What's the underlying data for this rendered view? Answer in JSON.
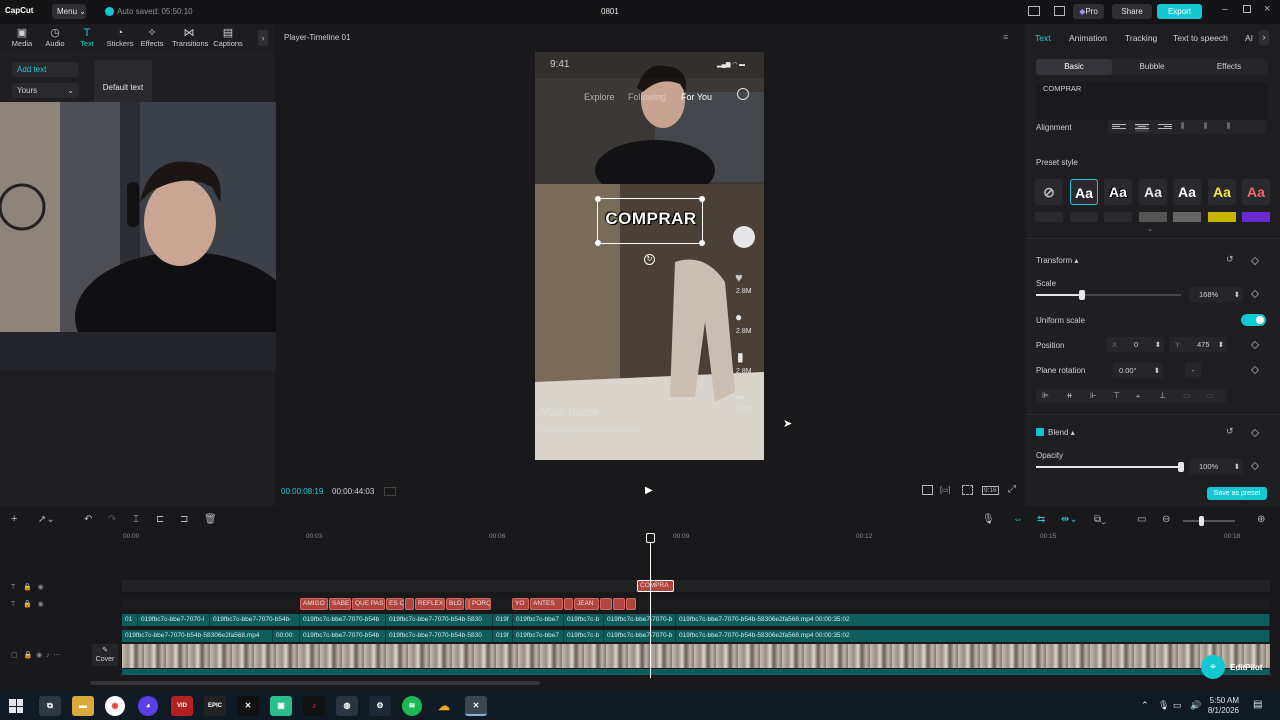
{
  "app": {
    "logo": "CapCut",
    "menu_label": "Menu",
    "autosave": "Auto saved: 05:50:10",
    "project_name": "0801",
    "pro_label": "Pro",
    "share_label": "Share",
    "export_label": "Export",
    "accent": "#13c8d2"
  },
  "tools": [
    {
      "label": "Media",
      "icon": "media-icon"
    },
    {
      "label": "Audio",
      "icon": "audio-icon"
    },
    {
      "label": "Text",
      "icon": "text-icon"
    },
    {
      "label": "Stickers",
      "icon": "stickers-icon"
    },
    {
      "label": "Effects",
      "icon": "effects-icon"
    },
    {
      "label": "Transitions",
      "icon": "transitions-icon"
    },
    {
      "label": "Captions",
      "icon": "captions-icon"
    }
  ],
  "left_panel": {
    "add_text": "Add text",
    "dropdown": "Yours",
    "default_text": "Default text"
  },
  "player": {
    "title": "Player-Timeline 01",
    "current_time": "00:00:08:19",
    "total_time": "00:00:44:03",
    "phone": {
      "time": "9:41",
      "tabs": [
        "Explore",
        "Following",
        "For You"
      ],
      "overlay_text": "COMPRAR",
      "counts": [
        "2.8M",
        "2.8M",
        "2.8M",
        "2.8M"
      ],
      "username": "Your name",
      "caption": "Here is your video description title"
    }
  },
  "right_panel": {
    "tabs": [
      "Text",
      "Animation",
      "Tracking",
      "Text to speech",
      "AI"
    ],
    "subtabs": [
      "Basic",
      "Bubble",
      "Effects"
    ],
    "text_value": "COMPRAR",
    "alignment_label": "Alignment",
    "preset_label": "Preset style",
    "preset_glyph": "Aa",
    "transform_label": "Transform",
    "scale_label": "Scale",
    "scale_value": "168%",
    "scale_fraction": 0.32,
    "uniform_scale_label": "Uniform scale",
    "position_label": "Position",
    "pos_x_label": "X",
    "pos_x": "0",
    "pos_y_label": "Y",
    "pos_y": "475",
    "rotation_label": "Plane rotation",
    "rotation_value": "0.00°",
    "rotation_extra": "-",
    "blend_label": "Blend",
    "opacity_label": "Opacity",
    "opacity_value": "100%",
    "opacity_fraction": 1.0,
    "save_preset": "Save as preset"
  },
  "timeline": {
    "ticks": [
      "00:00",
      "00:03",
      "00:06",
      "00:09",
      "00:12",
      "00:15",
      "00:18"
    ],
    "cover_label": "Cover",
    "text_clip": "COMPRA",
    "red_clips": [
      "AMIGO",
      "SABE",
      "QUE PAS",
      "ES C",
      "",
      "REFLEX",
      "BLD",
      "",
      "PORQ",
      "YO",
      "ANTES",
      "JEAN",
      "",
      "",
      ""
    ],
    "teal_row1": [
      "01",
      "019fbc7c-bbe7-7070-l",
      "019fbc7c-bbe7-7070-b54b-",
      "019fbc7c-bbe7-7070-b54b",
      "019fbc7c-bbe7-7070-b54b-5830",
      "019f",
      "019fbc7c-bbe7",
      "019fbc7c-b",
      "019fbc7c-bbe7-7070-b",
      "019fbc7c-bbe7-7070-b54b-58306e2fa568.mp4  00:00:35:02"
    ],
    "teal_row2": [
      "019fbc7c-bbe7-7070-b54b-58306e2fa568.mp4",
      "00:00:",
      "019fbc7c-bbe7-7070-b54b",
      "019fbc7c-bbe7-7070-b54b-5830",
      "019f",
      "019fbc7c-bbe7",
      "019fbc7c-b",
      "019fbc7c-bbe7-7070-b",
      "019fbc7c-bbe7-7070-b54b-58306e2fa568.mp4  00:00:35:02"
    ]
  },
  "editpilot": "EditPilot",
  "taskbar": {
    "time": "5:50 AM",
    "date": "8/1/2026"
  }
}
